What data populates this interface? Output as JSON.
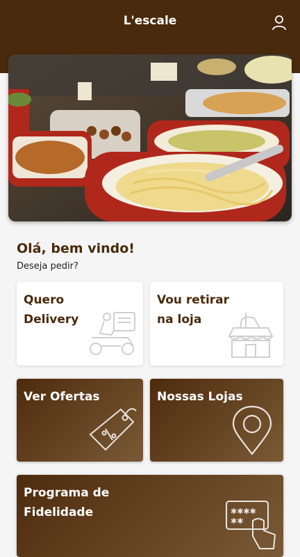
{
  "header": {
    "title": "L'escale",
    "user_icon": "user-icon"
  },
  "hero": {
    "image": "buffet-food-photo"
  },
  "welcome": {
    "title": "Olá, bem vindo!",
    "subtitle": "Deseja pedir?"
  },
  "cards": {
    "delivery": {
      "label": "Quero\nDelivery",
      "icon": "delivery-scooter-icon"
    },
    "pickup": {
      "label": "Vou retirar\nna loja",
      "icon": "store-pickup-icon"
    },
    "offers": {
      "label": "Ver Ofertas",
      "icon": "price-tag-icon"
    },
    "stores": {
      "label": "Nossas Lojas",
      "icon": "map-pin-icon"
    },
    "loyalty": {
      "label": "Programa de\nFidelidade",
      "icon": "loyalty-card-icon"
    }
  },
  "colors": {
    "brand": "#4a2a0c",
    "card_gradient_end": "#7a5a36",
    "background": "#f5f5f5"
  }
}
